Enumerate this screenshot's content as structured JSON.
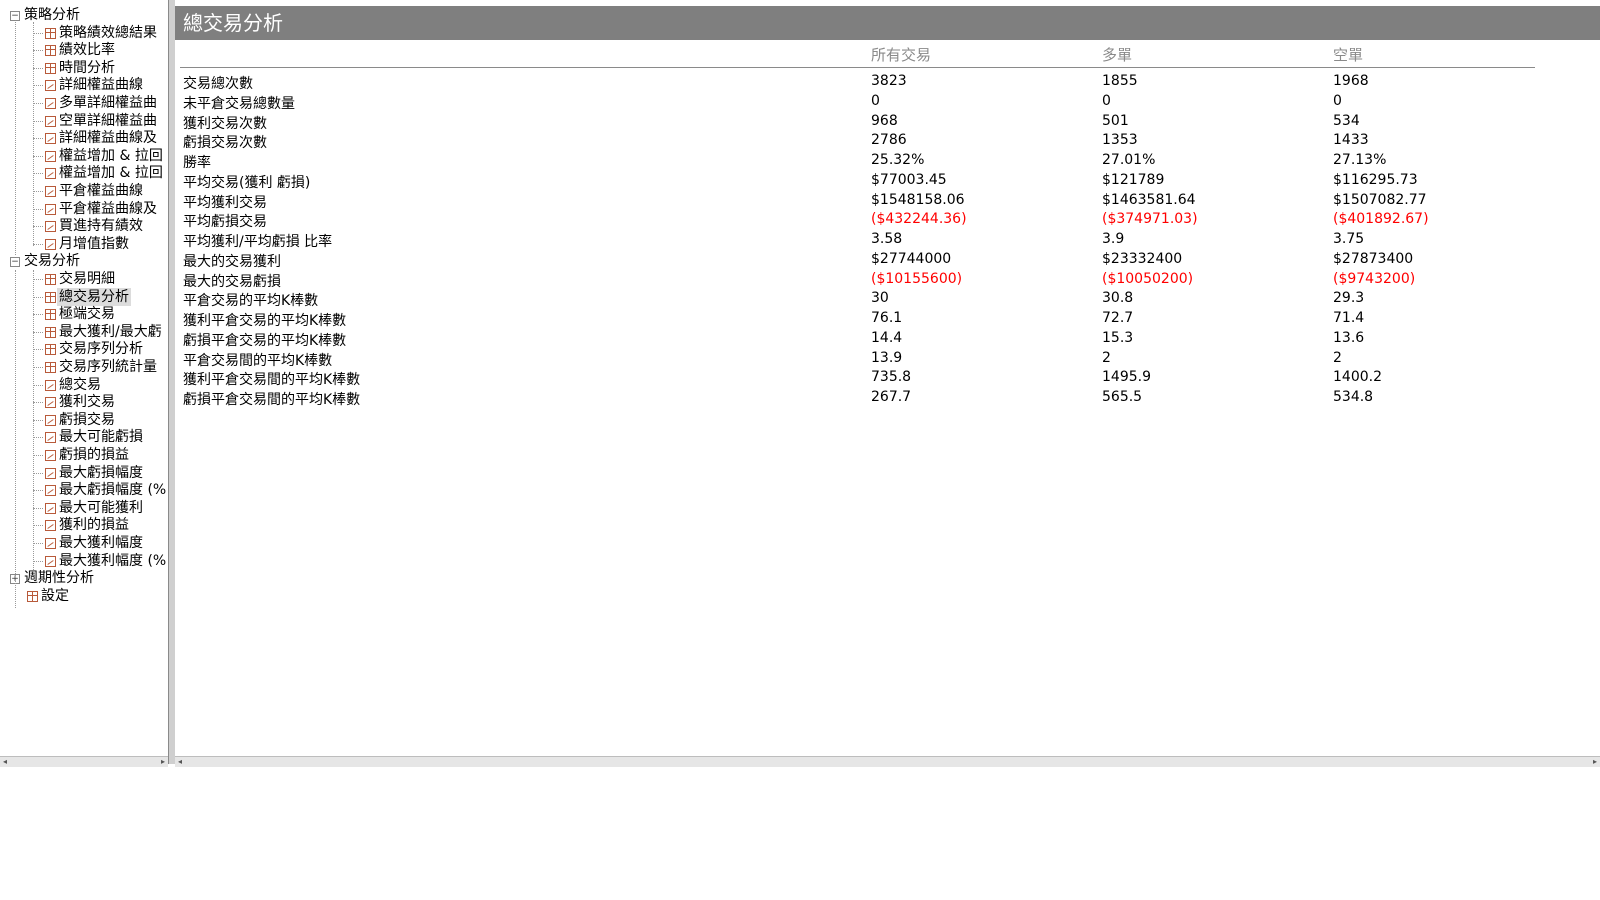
{
  "tree": {
    "nodes": [
      {
        "label": "策略分析",
        "level": 0,
        "kind": "folder",
        "expanded": true
      },
      {
        "label": "策略績效總結果",
        "level": 1,
        "kind": "table"
      },
      {
        "label": "績效比率",
        "level": 1,
        "kind": "table"
      },
      {
        "label": "時間分析",
        "level": 1,
        "kind": "table"
      },
      {
        "label": "詳細權益曲線",
        "level": 1,
        "kind": "chart"
      },
      {
        "label": "多單詳細權益曲",
        "level": 1,
        "kind": "chart"
      },
      {
        "label": "空單詳細權益曲",
        "level": 1,
        "kind": "chart"
      },
      {
        "label": "詳細權益曲線及",
        "level": 1,
        "kind": "chart"
      },
      {
        "label": "權益增加 & 拉回",
        "level": 1,
        "kind": "chart"
      },
      {
        "label": "權益增加 & 拉回",
        "level": 1,
        "kind": "chart"
      },
      {
        "label": "平倉權益曲線",
        "level": 1,
        "kind": "chart"
      },
      {
        "label": "平倉權益曲線及",
        "level": 1,
        "kind": "chart"
      },
      {
        "label": "買進持有績效",
        "level": 1,
        "kind": "chart"
      },
      {
        "label": "月增值指數",
        "level": 1,
        "kind": "chart"
      },
      {
        "label": "交易分析",
        "level": 0,
        "kind": "folder",
        "expanded": true
      },
      {
        "label": "交易明細",
        "level": 1,
        "kind": "table"
      },
      {
        "label": "總交易分析",
        "level": 1,
        "kind": "table",
        "selected": true
      },
      {
        "label": "極端交易",
        "level": 1,
        "kind": "table"
      },
      {
        "label": "最大獲利/最大虧",
        "level": 1,
        "kind": "table"
      },
      {
        "label": "交易序列分析",
        "level": 1,
        "kind": "table"
      },
      {
        "label": "交易序列統計量",
        "level": 1,
        "kind": "table"
      },
      {
        "label": "總交易",
        "level": 1,
        "kind": "chart"
      },
      {
        "label": "獲利交易",
        "level": 1,
        "kind": "chart"
      },
      {
        "label": "虧損交易",
        "level": 1,
        "kind": "chart"
      },
      {
        "label": "最大可能虧損",
        "level": 1,
        "kind": "chart"
      },
      {
        "label": "虧損的損益",
        "level": 1,
        "kind": "chart"
      },
      {
        "label": "最大虧損幅度",
        "level": 1,
        "kind": "chart"
      },
      {
        "label": "最大虧損幅度 (%",
        "level": 1,
        "kind": "chart"
      },
      {
        "label": "最大可能獲利",
        "level": 1,
        "kind": "chart"
      },
      {
        "label": "獲利的損益",
        "level": 1,
        "kind": "chart"
      },
      {
        "label": "最大獲利幅度",
        "level": 1,
        "kind": "chart"
      },
      {
        "label": "最大獲利幅度 (%",
        "level": 1,
        "kind": "chart"
      },
      {
        "label": "週期性分析",
        "level": 0,
        "kind": "folder",
        "expanded": false
      },
      {
        "label": "設定",
        "level": 0,
        "kind": "table-leaf"
      }
    ]
  },
  "main": {
    "title": "總交易分析",
    "columns": [
      "所有交易",
      "多單",
      "空單"
    ],
    "rows": [
      {
        "label": "交易總次數",
        "values": [
          "3823",
          "1855",
          "1968"
        ],
        "negative": false
      },
      {
        "label": "未平倉交易總數量",
        "values": [
          "0",
          "0",
          "0"
        ],
        "negative": false
      },
      {
        "label": "獲利交易次數",
        "values": [
          "968",
          "501",
          "534"
        ],
        "negative": false
      },
      {
        "label": "虧損交易次數",
        "values": [
          "2786",
          "1353",
          "1433"
        ],
        "negative": false
      },
      {
        "label": "勝率",
        "values": [
          "25.32%",
          "27.01%",
          "27.13%"
        ],
        "negative": false
      },
      {
        "label": "平均交易(獲利  虧損)",
        "values": [
          "$77003.45",
          "$121789",
          "$116295.73"
        ],
        "negative": false
      },
      {
        "label": "平均獲利交易",
        "values": [
          "$1548158.06",
          "$1463581.64",
          "$1507082.77"
        ],
        "negative": false
      },
      {
        "label": "平均虧損交易",
        "values": [
          "($432244.36)",
          "($374971.03)",
          "($401892.67)"
        ],
        "negative": true
      },
      {
        "label": "平均獲利/平均虧損 比率",
        "values": [
          "3.58",
          "3.9",
          "3.75"
        ],
        "negative": false
      },
      {
        "label": "最大的交易獲利",
        "values": [
          "$27744000",
          "$23332400",
          "$27873400"
        ],
        "negative": false
      },
      {
        "label": "最大的交易虧損",
        "values": [
          "($10155600)",
          "($10050200)",
          "($9743200)"
        ],
        "negative": true
      },
      {
        "label": "平倉交易的平均K棒數",
        "values": [
          "30",
          "30.8",
          "29.3"
        ],
        "negative": false
      },
      {
        "label": "獲利平倉交易的平均K棒數",
        "values": [
          "76.1",
          "72.7",
          "71.4"
        ],
        "negative": false
      },
      {
        "label": "虧損平倉交易的平均K棒數",
        "values": [
          "14.4",
          "15.3",
          "13.6"
        ],
        "negative": false
      },
      {
        "label": "平倉交易間的平均K棒數",
        "values": [
          "13.9",
          "2",
          "2"
        ],
        "negative": false
      },
      {
        "label": "獲利平倉交易間的平均K棒數",
        "values": [
          "735.8",
          "1495.9",
          "1400.2"
        ],
        "negative": false
      },
      {
        "label": "虧損平倉交易間的平均K棒數",
        "values": [
          "267.7",
          "565.5",
          "534.8"
        ],
        "negative": false
      }
    ]
  },
  "colors": {
    "title_bar": "#7f7f7f",
    "negative": "#ff0000",
    "header_text": "#8a8a8a"
  }
}
